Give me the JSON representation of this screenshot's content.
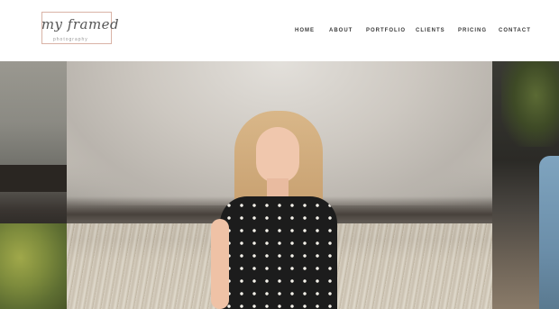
{
  "brand": {
    "script": "my framed",
    "subtitle": "photography"
  },
  "nav": {
    "items": [
      {
        "label": "HOME"
      },
      {
        "label": "ABOUT"
      },
      {
        "label": "PORTFOLIO"
      },
      {
        "label": "CLIENTS"
      },
      {
        "label": "PRICING"
      },
      {
        "label": "CONTACT"
      }
    ]
  },
  "colors": {
    "logo_frame": "#d9b3a6",
    "nav_text": "#3a3a3a"
  }
}
